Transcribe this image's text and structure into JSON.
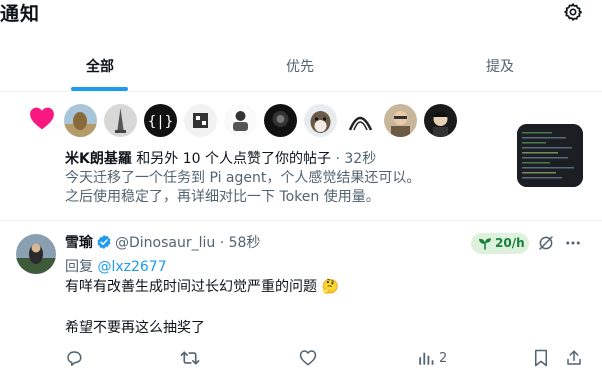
{
  "header": {
    "title": "通知",
    "settings_icon": "gear-icon"
  },
  "tabs": [
    {
      "label": "全部",
      "active": true
    },
    {
      "label": "优先",
      "active": false
    },
    {
      "label": "提及",
      "active": false
    }
  ],
  "like_notification": {
    "icon": "heart-icon",
    "avatar_count": 10,
    "actor_name": "米K朗基羅",
    "action_text": " 和另外 10 个人点赞了你的帖子",
    "time": " · 32秒",
    "post_line1": "今天迁移了一个任务到 Pi agent，个人感觉结果还可以。",
    "post_line2": "之后使用稳定了，再详细对比一下 Token 使用量。"
  },
  "reply_notification": {
    "author_name": "雪瑜",
    "author_handle": "@Dinosaur_liu",
    "time": "· 58秒",
    "reply_to_label": "回复 ",
    "reply_to_handle": "@lxz2677",
    "line1": "有咩有改善生成时间过长幻觉严重的问题 🤔",
    "line2": "希望不要再这么抽奖了",
    "rate_badge": "20/h",
    "actions": {
      "view_count": "2"
    }
  },
  "colors": {
    "accent": "#1d9bf0",
    "heart": "#f91880",
    "rate_badge_bg": "#def1dc",
    "rate_badge_fg": "#17803d",
    "muted_text": "#536471"
  }
}
